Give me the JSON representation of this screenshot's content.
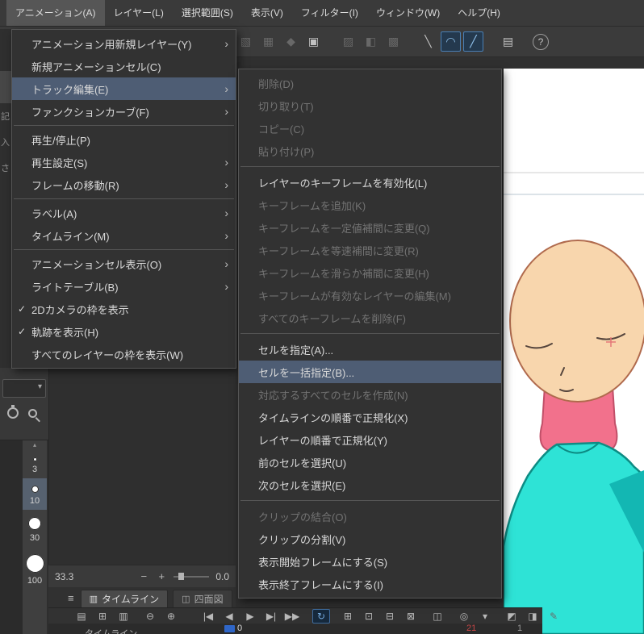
{
  "colors": {
    "menu_highlight": "#4e5d74",
    "toolbar_active_blue": "#4a7fb5",
    "playhead_blue": "#2f66c8",
    "frame_red": "#c64545",
    "canvas_skin": "#f8d6ad",
    "canvas_pink": "#f2718c",
    "canvas_teal": "#2ee3d6",
    "canvas_teal_shadow": "#13b7b3",
    "cross_red": "#e57878"
  },
  "menubar": {
    "items": [
      {
        "key": "animation",
        "label": "アニメーション(A)",
        "active": true
      },
      {
        "key": "layer",
        "label": "レイヤー(L)"
      },
      {
        "key": "select",
        "label": "選択範囲(S)"
      },
      {
        "key": "view",
        "label": "表示(V)"
      },
      {
        "key": "filter",
        "label": "フィルター(I)"
      },
      {
        "key": "window",
        "label": "ウィンドウ(W)"
      },
      {
        "key": "help",
        "label": "ヘルプ(H)"
      }
    ]
  },
  "toolbar": {
    "groups": [
      [
        {
          "name": "select-area-icon",
          "glyph": "▧",
          "state": "disabled"
        },
        {
          "name": "select-extra-icon",
          "glyph": "▦",
          "state": "disabled"
        },
        {
          "name": "select-shape-icon",
          "glyph": "◆",
          "state": "disabled"
        },
        {
          "name": "transform-frame-icon",
          "glyph": "▣",
          "state": "normal"
        }
      ],
      [
        {
          "name": "mask-area-icon",
          "glyph": "▨",
          "state": "disabled"
        },
        {
          "name": "mask-half-icon",
          "glyph": "◧",
          "state": "disabled"
        },
        {
          "name": "mask-grid-icon",
          "glyph": "▩",
          "state": "disabled"
        }
      ],
      [
        {
          "name": "snap-line-icon",
          "glyph": "╲",
          "state": "normal"
        },
        {
          "name": "snap-curve-icon",
          "glyph": "◠",
          "state": "active"
        },
        {
          "name": "snap-ruler-icon",
          "glyph": "╱",
          "state": "active"
        }
      ],
      [
        {
          "name": "numpad-panel-icon",
          "glyph": "▤",
          "state": "normal"
        }
      ],
      [
        {
          "name": "help-icon",
          "glyph": "?",
          "state": "normal"
        }
      ]
    ]
  },
  "animation_menu": {
    "items": [
      {
        "key": "new-anim-layer",
        "label": "アニメーション用新規レイヤー(Y)",
        "arrow": true
      },
      {
        "key": "new-anim-cell",
        "label": "新規アニメーションセル(C)"
      },
      {
        "key": "track-edit",
        "label": "トラック編集(E)",
        "arrow": true,
        "highlight": true
      },
      {
        "key": "function-curve",
        "label": "ファンクションカーブ(F)",
        "arrow": true
      },
      {
        "sep": true
      },
      {
        "key": "play-stop",
        "label": "再生/停止(P)"
      },
      {
        "key": "playback-settings",
        "label": "再生設定(S)",
        "arrow": true
      },
      {
        "key": "move-frame",
        "label": "フレームの移動(R)",
        "arrow": true
      },
      {
        "sep": true
      },
      {
        "key": "label",
        "label": "ラベル(A)",
        "arrow": true
      },
      {
        "key": "timeline",
        "label": "タイムライン(M)",
        "arrow": true
      },
      {
        "sep": true
      },
      {
        "key": "cell-display",
        "label": "アニメーションセル表示(O)",
        "arrow": true
      },
      {
        "key": "light-table",
        "label": "ライトテーブル(B)",
        "arrow": true
      },
      {
        "key": "show-2d-camera-frame",
        "label": "2Dカメラの枠を表示",
        "check": true
      },
      {
        "key": "show-trajectory",
        "label": "軌跡を表示(H)",
        "check": true
      },
      {
        "key": "show-all-layer-frames",
        "label": "すべてのレイヤーの枠を表示(W)"
      }
    ]
  },
  "track_edit_submenu": {
    "items": [
      {
        "key": "delete",
        "label": "削除(D)",
        "disabled": true
      },
      {
        "key": "cut",
        "label": "切り取り(T)",
        "disabled": true
      },
      {
        "key": "copy",
        "label": "コピー(C)",
        "disabled": true
      },
      {
        "key": "paste",
        "label": "貼り付け(P)",
        "disabled": true
      },
      {
        "sep": true
      },
      {
        "key": "enable-layer-keyframes",
        "label": "レイヤーのキーフレームを有効化(L)"
      },
      {
        "key": "add-keyframe",
        "label": "キーフレームを追加(K)",
        "disabled": true
      },
      {
        "key": "keyframe-constant",
        "label": "キーフレームを一定値補間に変更(Q)",
        "disabled": true
      },
      {
        "key": "keyframe-linear",
        "label": "キーフレームを等速補間に変更(R)",
        "disabled": true
      },
      {
        "key": "keyframe-smooth",
        "label": "キーフレームを滑らか補間に変更(H)",
        "disabled": true
      },
      {
        "key": "edit-keyframe-layer",
        "label": "キーフレームが有効なレイヤーの編集(M)",
        "disabled": true
      },
      {
        "key": "delete-all-keyframes",
        "label": "すべてのキーフレームを削除(F)",
        "disabled": true
      },
      {
        "sep": true
      },
      {
        "key": "specify-cell",
        "label": "セルを指定(A)..."
      },
      {
        "key": "batch-specify-cells",
        "label": "セルを一括指定(B)...",
        "highlight": true
      },
      {
        "key": "create-all-cells",
        "label": "対応するすべてのセルを作成(N)",
        "disabled": true
      },
      {
        "key": "normalize-timeline-order",
        "label": "タイムラインの順番で正規化(X)"
      },
      {
        "key": "normalize-layer-order",
        "label": "レイヤーの順番で正規化(Y)"
      },
      {
        "key": "select-prev-cell",
        "label": "前のセルを選択(U)"
      },
      {
        "key": "select-next-cell",
        "label": "次のセルを選択(E)"
      },
      {
        "sep": true
      },
      {
        "key": "merge-clips",
        "label": "クリップの結合(O)",
        "disabled": true
      },
      {
        "key": "split-clip",
        "label": "クリップの分割(V)"
      },
      {
        "key": "set-start-frame",
        "label": "表示開始フレームにする(S)"
      },
      {
        "key": "set-end-frame",
        "label": "表示終了フレームにする(I)"
      }
    ]
  },
  "left_panel": {
    "edge_chars": [
      "記",
      "入",
      "さ"
    ],
    "combo_arrow": "▾",
    "scroll_up_glyph": "▴",
    "brush_sizes": [
      {
        "size": "3",
        "dot": 5
      },
      {
        "size": "10",
        "dot": 9,
        "selected": true
      },
      {
        "size": "30",
        "dot": 16
      },
      {
        "size": "100",
        "dot": 23
      }
    ],
    "scale_value": "33.3",
    "minus_glyph": "−",
    "plus_glyph": "+",
    "offset_value": "0.0"
  },
  "timeline": {
    "menu_glyph": "≡",
    "tabs": [
      {
        "label": "タイムライン",
        "icon": "▥",
        "active": true
      },
      {
        "label": "四面図",
        "icon": "◫",
        "active": false
      }
    ],
    "transport_groups": [
      [
        {
          "name": "timeline-menu-icon",
          "glyph": "▤"
        },
        {
          "name": "new-timeline-icon",
          "glyph": "⊞"
        },
        {
          "name": "timeline-list-icon",
          "glyph": "▥"
        }
      ],
      [
        {
          "name": "zoom-out-icon",
          "glyph": "⊖"
        },
        {
          "name": "zoom-in-icon",
          "glyph": "⊕"
        }
      ],
      [
        {
          "name": "first-frame-icon",
          "glyph": "|◀"
        },
        {
          "name": "prev-frame-icon",
          "glyph": "◀"
        },
        {
          "name": "play-icon",
          "glyph": "▶"
        },
        {
          "name": "next-frame-icon",
          "glyph": "▶|"
        },
        {
          "name": "last-frame-icon",
          "glyph": "▶▶"
        }
      ],
      [
        {
          "name": "loop-playback-icon",
          "glyph": "↻",
          "state": "active"
        }
      ],
      [
        {
          "name": "new-animation-cell-icon",
          "glyph": "⊞"
        },
        {
          "name": "new-cell-folder-icon",
          "glyph": "⊡"
        },
        {
          "name": "specify-cell-icon",
          "glyph": "⊟"
        },
        {
          "name": "batch-specify-cell-icon",
          "glyph": "⊠"
        }
      ],
      [
        {
          "name": "light-table-icon",
          "glyph": "◫"
        }
      ],
      [
        {
          "name": "onion-skin-icon",
          "glyph": "◎"
        },
        {
          "name": "onion-skin-menu-icon",
          "glyph": "▾"
        }
      ],
      [
        {
          "name": "camera-folder-icon",
          "glyph": "◩"
        },
        {
          "name": "export-animation-icon",
          "glyph": "◨"
        },
        {
          "name": "edit-track-icon",
          "glyph": "✎",
          "state": "disabled"
        }
      ]
    ],
    "selector_label": "タイムライン",
    "ruler": {
      "start_label": "0",
      "current_label": "21",
      "end_label": "1"
    }
  }
}
